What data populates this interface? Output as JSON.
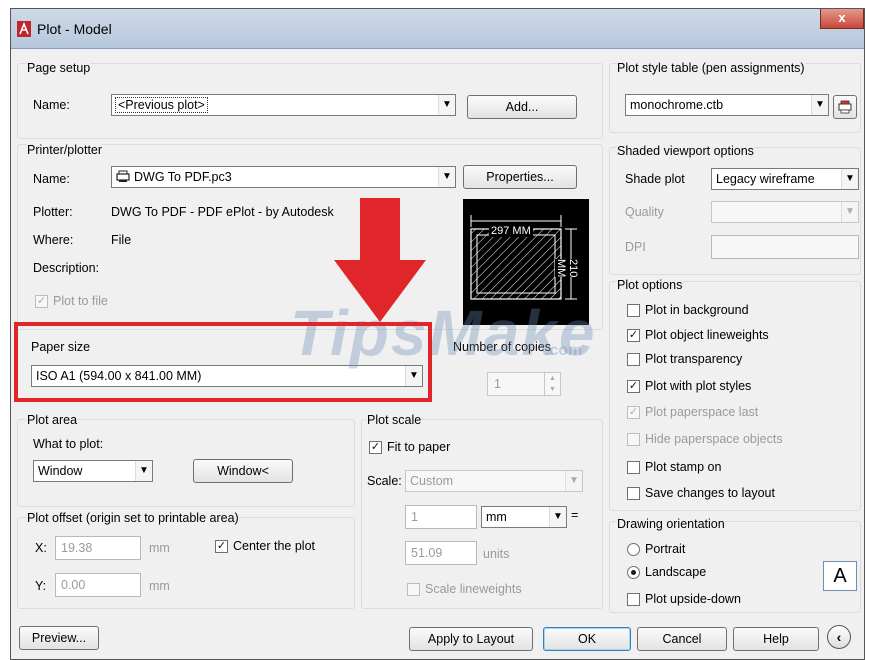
{
  "window": {
    "title": "Plot - Model",
    "close": "x"
  },
  "page_setup": {
    "group_label": "Page setup",
    "name_label": "Name:",
    "name_value": "<Previous plot>",
    "add_button": "Add..."
  },
  "printer": {
    "group_label": "Printer/plotter",
    "name_label": "Name:",
    "name_value": "DWG To PDF.pc3",
    "properties_button": "Properties...",
    "plotter_label": "Plotter:",
    "plotter_value": "DWG To PDF - PDF ePlot - by Autodesk",
    "where_label": "Where:",
    "where_value": "File",
    "description_label": "Description:",
    "plot_to_file_label": "Plot to file",
    "preview_width": "297 MM",
    "preview_height": "210 MM"
  },
  "paper_size": {
    "group_label": "Paper size",
    "value": "ISO A1 (594.00 x 841.00 MM)"
  },
  "copies": {
    "label": "Number of copies",
    "value": "1"
  },
  "plot_area": {
    "group_label": "Plot area",
    "what_label": "What to plot:",
    "what_value": "Window",
    "window_button": "Window<"
  },
  "plot_offset": {
    "group_label": "Plot offset (origin set to printable area)",
    "x_label": "X:",
    "x_value": "19.38",
    "x_unit": "mm",
    "y_label": "Y:",
    "y_value": "0.00",
    "y_unit": "mm",
    "center_label": "Center the plot"
  },
  "plot_scale": {
    "group_label": "Plot scale",
    "fit_label": "Fit to paper",
    "scale_label": "Scale:",
    "scale_value": "Custom",
    "value1": "1",
    "unit_value": "mm",
    "equals": "=",
    "value2": "51.09",
    "units_label": "units",
    "lineweights_label": "Scale lineweights"
  },
  "plot_style": {
    "group_label": "Plot style table (pen assignments)",
    "value": "monochrome.ctb"
  },
  "shaded": {
    "group_label": "Shaded viewport options",
    "shade_label": "Shade plot",
    "shade_value": "Legacy wireframe",
    "quality_label": "Quality",
    "dpi_label": "DPI"
  },
  "plot_options": {
    "group_label": "Plot options",
    "items": [
      {
        "label": "Plot in background",
        "checked": false,
        "enabled": true
      },
      {
        "label": "Plot object lineweights",
        "checked": true,
        "enabled": true
      },
      {
        "label": "Plot transparency",
        "checked": false,
        "enabled": true
      },
      {
        "label": "Plot with plot styles",
        "checked": true,
        "enabled": true
      },
      {
        "label": "Plot paperspace last",
        "checked": true,
        "enabled": false
      },
      {
        "label": "Hide paperspace objects",
        "checked": false,
        "enabled": false
      },
      {
        "label": "Plot stamp on",
        "checked": false,
        "enabled": true
      },
      {
        "label": "Save changes to layout",
        "checked": false,
        "enabled": true
      }
    ]
  },
  "orientation": {
    "group_label": "Drawing orientation",
    "portrait": "Portrait",
    "landscape": "Landscape",
    "upside_down": "Plot upside-down",
    "orientation_icon": "A"
  },
  "footer": {
    "preview": "Preview...",
    "apply": "Apply to Layout",
    "ok": "OK",
    "cancel": "Cancel",
    "help": "Help"
  },
  "watermark": {
    "main": "TipsMake",
    "sub": ".com"
  },
  "colors": {
    "highlight": "#e0262a",
    "title_bar": "#b6c7dc"
  }
}
